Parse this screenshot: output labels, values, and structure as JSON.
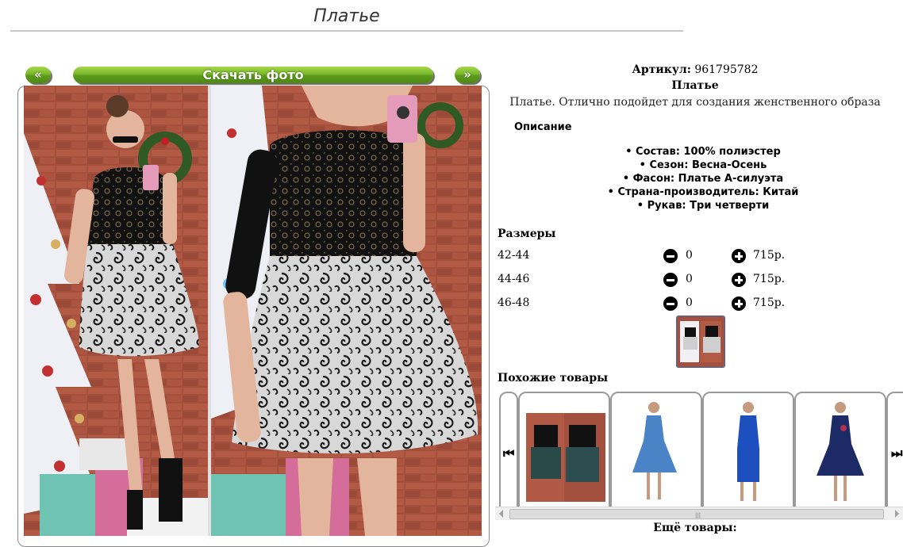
{
  "page": {
    "title": "Платье"
  },
  "gallery": {
    "prev_label": "«",
    "download_label": "Скачать фото",
    "next_label": "»"
  },
  "product": {
    "sku_label": "Артикул:",
    "sku_value": "961795782",
    "name": "Платье",
    "short_description": "Платье. Отлично подойдет для создания женственного образа",
    "description_heading": "Описание",
    "specs": [
      "Состав: 100% полиэстер",
      "Сезон: Весна-Осень",
      "Фасон: Платье А-силуэта",
      "Страна-производитель: Китай",
      "Рукав: Три четверти"
    ]
  },
  "sizes": {
    "heading": "Размеры",
    "rows": [
      {
        "label": "42-44",
        "qty": "0",
        "price": "715р."
      },
      {
        "label": "44-46",
        "qty": "0",
        "price": "715р."
      },
      {
        "label": "46-48",
        "qty": "0",
        "price": "715р."
      }
    ]
  },
  "similar": {
    "heading": "Похожие товары",
    "items": [
      {
        "icon": "dress-black-lace-icon"
      },
      {
        "icon": "dress-light-blue-icon"
      },
      {
        "icon": "dress-royal-blue-icon"
      },
      {
        "icon": "dress-navy-embroidered-icon"
      }
    ]
  },
  "more": {
    "heading": "Ещё товары:"
  },
  "colors": {
    "accent_green": "#6aaa22",
    "thumb_border": "#3a6aa0"
  }
}
